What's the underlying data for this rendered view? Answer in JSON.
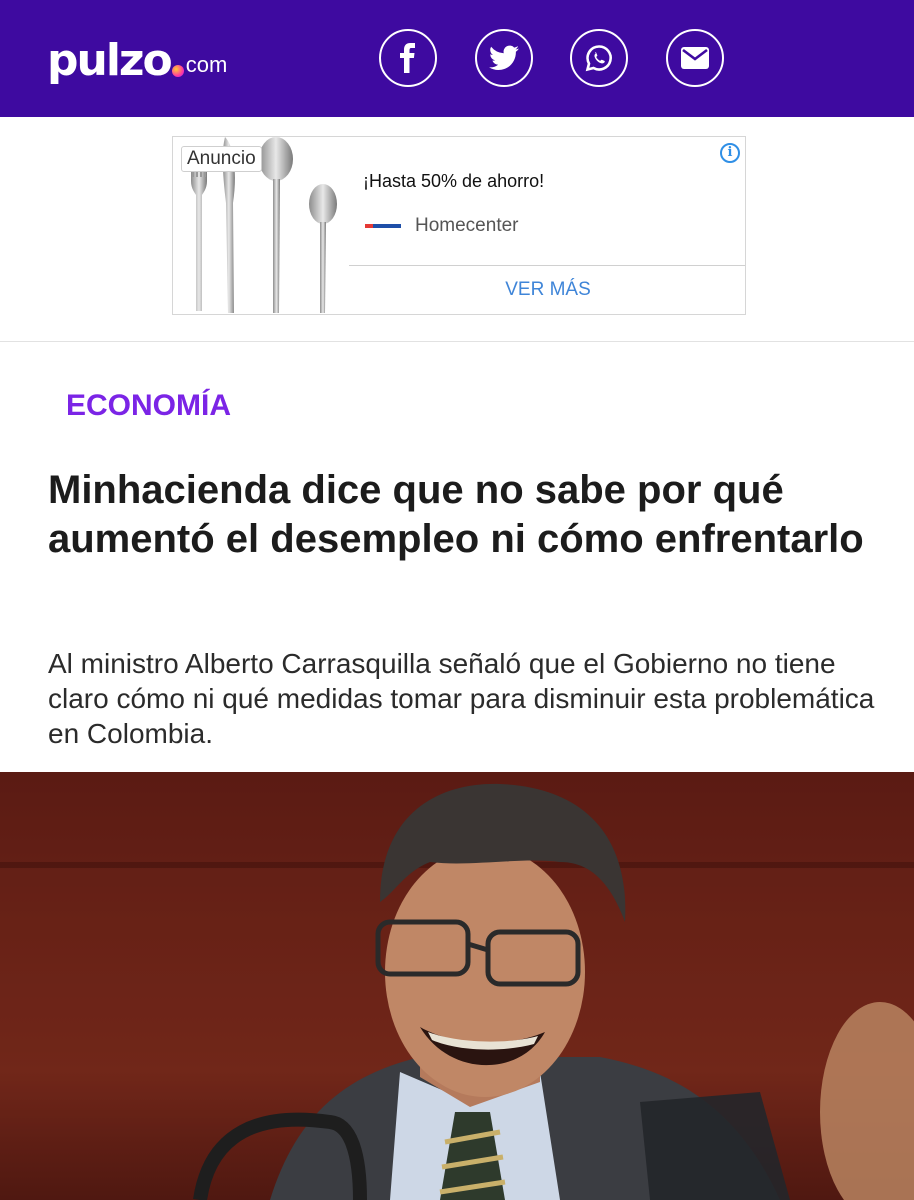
{
  "header": {
    "logo_word": "pulzo",
    "logo_domain": "com",
    "background": "#3e0aa0",
    "share_icons": [
      "facebook-icon",
      "twitter-icon",
      "whatsapp-icon",
      "mail-icon"
    ]
  },
  "ad": {
    "label": "Anuncio",
    "info_icon": "i",
    "headline": "¡Hasta 50% de ahorro!",
    "brand": "Homecenter",
    "cta": "VER MÁS"
  },
  "article": {
    "section": "ECONOMÍA",
    "section_color": "#7b24e6",
    "title": "Minhacienda dice que no sabe por qué aumentó el desempleo ni cómo enfrentarlo",
    "subtitle": "Al ministro Alberto Carrasquilla señaló que el Gobierno no tiene claro cómo ni qué medidas tomar para disminuir esta problemática en Colombia."
  }
}
